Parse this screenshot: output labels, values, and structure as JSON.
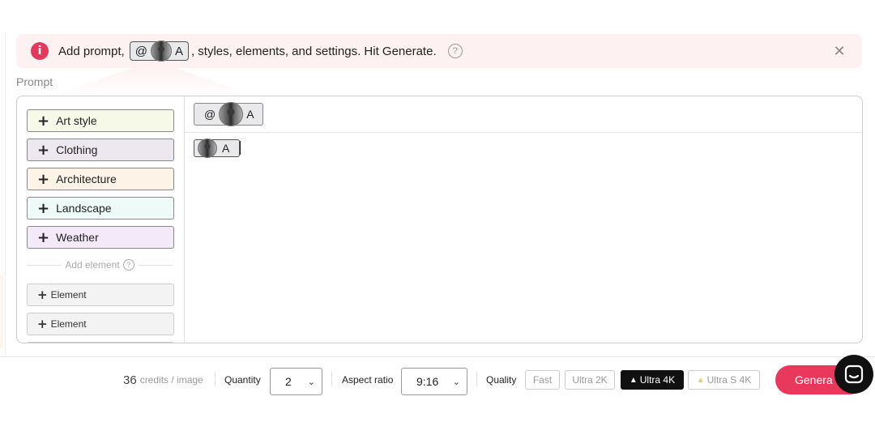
{
  "banner": {
    "text_before": "Add prompt,",
    "chip_at": "@",
    "chip_letter": "A",
    "text_after": ", styles, elements, and settings. Hit Generate.",
    "help_symbol": "?",
    "close_symbol": "✕",
    "info_icon": "info-icon"
  },
  "prompt": {
    "label": "Prompt",
    "style_buttons": [
      {
        "label": "Art style",
        "bg": "#f6f8e8"
      },
      {
        "label": "Clothing",
        "bg": "#ede8ef"
      },
      {
        "label": "Architecture",
        "bg": "#fdf3e6"
      },
      {
        "label": "Landscape",
        "bg": "#eefaf8"
      },
      {
        "label": "Weather",
        "bg": "#f4e9f9"
      }
    ],
    "add_element_label": "Add element",
    "add_element_help": "?",
    "element_buttons": [
      {
        "label": "Element"
      },
      {
        "label": "Element"
      }
    ],
    "ref_chip": {
      "at": "@",
      "letter": "A"
    },
    "inline_chip": {
      "letter": "A"
    }
  },
  "bottom": {
    "credits_number": "36",
    "credits_unit": "credits / image",
    "quantity_label": "Quantity",
    "quantity_value": "2",
    "aspect_label": "Aspect ratio",
    "aspect_value": "9:16",
    "quality_label": "Quality",
    "quality_options": [
      {
        "label": "Fast",
        "active": false
      },
      {
        "label": "Ultra 2K",
        "active": false
      },
      {
        "label": "Ultra 4K",
        "active": true
      },
      {
        "label": "Ultra S 4K",
        "active": false
      }
    ],
    "generate_label": "Genera"
  },
  "colors": {
    "accent": "#e8395d",
    "banner_bg": "#fdf1f1"
  }
}
